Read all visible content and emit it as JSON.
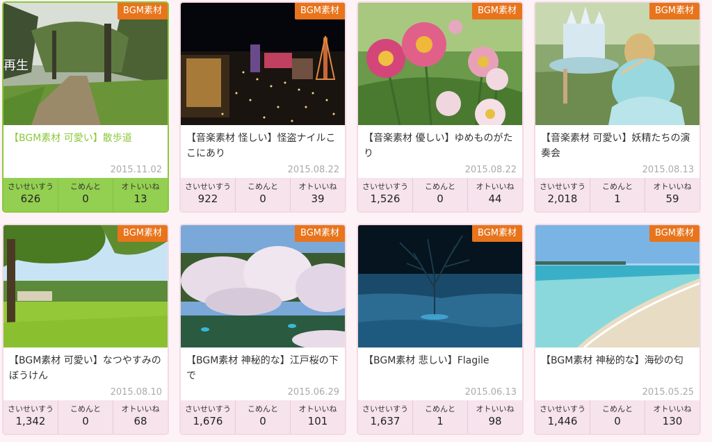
{
  "tag_label": "BGM素材",
  "play_label": "再生",
  "stat_labels": [
    "さいせいすう",
    "こめんと",
    "オトいいね"
  ],
  "colors": {
    "accent_orange": "#e8741c",
    "active_green": "#8cc83c",
    "card_border_pink": "#f4d9e4",
    "stats_bg_pink": "#f6e3ec"
  },
  "cards": [
    {
      "title": "【BGM素材 可愛い】散歩道",
      "date": "2015.11.02",
      "plays": "626",
      "comments": "0",
      "likes": "13",
      "image": "tree-lined-path"
    },
    {
      "title": "【音楽素材 怪しい】怪盗ナイルここにあり",
      "date": "2015.08.22",
      "plays": "922",
      "comments": "0",
      "likes": "39",
      "image": "night-city"
    },
    {
      "title": "【音楽素材 優しい】ゆめものがたり",
      "date": "2015.08.22",
      "plays": "1,526",
      "comments": "0",
      "likes": "44",
      "image": "pink-flowers"
    },
    {
      "title": "【音楽素材 可愛い】妖精たちの演奏会",
      "date": "2015.08.13",
      "plays": "2,018",
      "comments": "1",
      "likes": "59",
      "image": "fairy-girl"
    },
    {
      "title": "【BGM素材 可愛い】なつやすみのぼうけん",
      "date": "2015.08.10",
      "plays": "1,342",
      "comments": "0",
      "likes": "68",
      "image": "green-park"
    },
    {
      "title": "【BGM素材 神秘的な】江戸桜の下で",
      "date": "2015.06.29",
      "plays": "1,676",
      "comments": "0",
      "likes": "101",
      "image": "cherry-blossoms"
    },
    {
      "title": "【BGM素材 悲しい】Flagile",
      "date": "2015.06.13",
      "plays": "1,637",
      "comments": "1",
      "likes": "98",
      "image": "tree-in-water"
    },
    {
      "title": "【BGM素材 神秘的な】海砂の匂",
      "date": "2015.05.25",
      "plays": "1,446",
      "comments": "0",
      "likes": "130",
      "image": "beach"
    }
  ]
}
